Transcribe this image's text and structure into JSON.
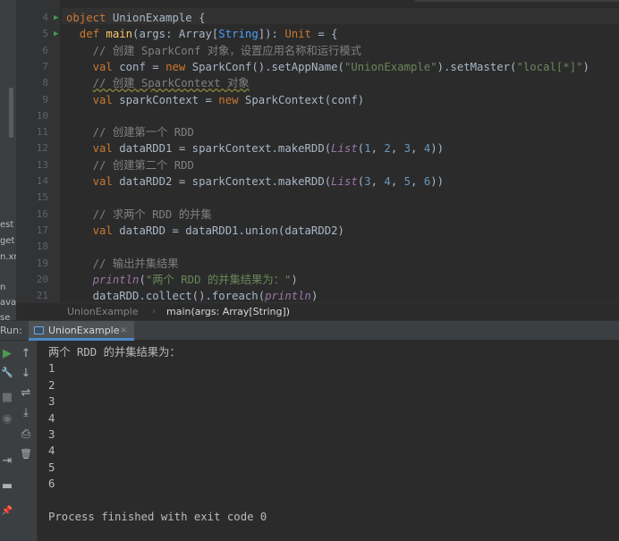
{
  "project_fragments": [
    "est",
    "get",
    "n.xn",
    "n",
    "ava",
    "se"
  ],
  "code_lines": [
    {
      "n": "4",
      "run": true,
      "fold": true,
      "segs": [
        {
          "t": "object ",
          "c": "kw"
        },
        {
          "t": "UnionExample {",
          "c": ""
        }
      ]
    },
    {
      "n": "5",
      "run": true,
      "fold": true,
      "segs": [
        {
          "t": "  def ",
          "c": "kw"
        },
        {
          "t": "main",
          "c": "fn"
        },
        {
          "t": "(args: Array[",
          "c": ""
        },
        {
          "t": "String",
          "c": "type"
        },
        {
          "t": "]): ",
          "c": ""
        },
        {
          "t": "Unit",
          "c": "kw"
        },
        {
          "t": " = {",
          "c": ""
        }
      ]
    },
    {
      "n": "6",
      "segs": [
        {
          "t": "    // 创建 SparkConf 对象，设置应用名称和运行模式",
          "c": "cmt"
        }
      ]
    },
    {
      "n": "7",
      "segs": [
        {
          "t": "    val ",
          "c": "kw"
        },
        {
          "t": "conf = ",
          "c": ""
        },
        {
          "t": "new ",
          "c": "kw"
        },
        {
          "t": "SparkConf().setAppName(",
          "c": ""
        },
        {
          "t": "\"UnionExample\"",
          "c": "str"
        },
        {
          "t": ").setMaster(",
          "c": ""
        },
        {
          "t": "\"local[*]\"",
          "c": "str"
        },
        {
          "t": ")",
          "c": ""
        }
      ]
    },
    {
      "n": "8",
      "segs": [
        {
          "t": "    ",
          "c": ""
        },
        {
          "t": "// 创建 SparkContext 对象",
          "c": "cmt-u"
        }
      ]
    },
    {
      "n": "9",
      "segs": [
        {
          "t": "    val ",
          "c": "kw"
        },
        {
          "t": "sparkContext = ",
          "c": ""
        },
        {
          "t": "new ",
          "c": "kw"
        },
        {
          "t": "SparkContext(conf)",
          "c": ""
        }
      ]
    },
    {
      "n": "10",
      "segs": []
    },
    {
      "n": "11",
      "segs": [
        {
          "t": "    // 创建第一个 RDD",
          "c": "cmt"
        }
      ]
    },
    {
      "n": "12",
      "segs": [
        {
          "t": "    val ",
          "c": "kw"
        },
        {
          "t": "dataRDD1 = sparkContext.makeRDD(",
          "c": ""
        },
        {
          "t": "List",
          "c": "ital"
        },
        {
          "t": "(",
          "c": ""
        },
        {
          "t": "1",
          "c": "num"
        },
        {
          "t": ", ",
          "c": ""
        },
        {
          "t": "2",
          "c": "num"
        },
        {
          "t": ", ",
          "c": ""
        },
        {
          "t": "3",
          "c": "num"
        },
        {
          "t": ", ",
          "c": ""
        },
        {
          "t": "4",
          "c": "num"
        },
        {
          "t": "))",
          "c": ""
        }
      ]
    },
    {
      "n": "13",
      "segs": [
        {
          "t": "    // 创建第二个 RDD",
          "c": "cmt"
        }
      ]
    },
    {
      "n": "14",
      "segs": [
        {
          "t": "    val ",
          "c": "kw"
        },
        {
          "t": "dataRDD2 = sparkContext.makeRDD(",
          "c": ""
        },
        {
          "t": "List",
          "c": "ital"
        },
        {
          "t": "(",
          "c": ""
        },
        {
          "t": "3",
          "c": "num"
        },
        {
          "t": ", ",
          "c": ""
        },
        {
          "t": "4",
          "c": "num"
        },
        {
          "t": ", ",
          "c": ""
        },
        {
          "t": "5",
          "c": "num"
        },
        {
          "t": ", ",
          "c": ""
        },
        {
          "t": "6",
          "c": "num"
        },
        {
          "t": "))",
          "c": ""
        }
      ]
    },
    {
      "n": "15",
      "segs": []
    },
    {
      "n": "16",
      "segs": [
        {
          "t": "    // 求两个 RDD 的并集",
          "c": "cmt"
        }
      ]
    },
    {
      "n": "17",
      "segs": [
        {
          "t": "    val ",
          "c": "kw"
        },
        {
          "t": "dataRDD = dataRDD1.union(dataRDD2)",
          "c": ""
        }
      ]
    },
    {
      "n": "18",
      "segs": []
    },
    {
      "n": "19",
      "segs": [
        {
          "t": "    // 输出并集结果",
          "c": "cmt"
        }
      ]
    },
    {
      "n": "20",
      "segs": [
        {
          "t": "    ",
          "c": ""
        },
        {
          "t": "println",
          "c": "ital"
        },
        {
          "t": "(",
          "c": ""
        },
        {
          "t": "\"两个 RDD 的并集结果为：\"",
          "c": "str"
        },
        {
          "t": ")",
          "c": ""
        }
      ]
    },
    {
      "n": "21",
      "segs": [
        {
          "t": "    dataRDD.collect().foreach(",
          "c": ""
        },
        {
          "t": "println",
          "c": "ital"
        },
        {
          "t": ")",
          "c": ""
        }
      ]
    }
  ],
  "breadcrumb": {
    "object": "UnionExample",
    "separator": "›",
    "method": "main(args: Array[String])"
  },
  "run_panel": {
    "label": "Run:",
    "tab_label": "UnionExample",
    "tab_close": "×"
  },
  "console_lines": [
    "两个 RDD 的并集结果为：",
    "1",
    "2",
    "3",
    "4",
    "3",
    "4",
    "5",
    "6",
    "",
    "Process finished with exit code 0"
  ],
  "icons": {
    "rerun": "▶",
    "settings": "🔧",
    "stop": "■",
    "camera": "◉",
    "exit": "⇥",
    "layout": "▬",
    "pin": "📌",
    "up": "↑",
    "down": "↓",
    "wrap": "⇌",
    "scroll_end": "⤓",
    "print": "⎙",
    "trash": "🗑"
  },
  "colors": {
    "keyword": "#cc7832",
    "string": "#6a8759",
    "number": "#6897bb",
    "comment": "#808080",
    "accent": "#4a88c7"
  }
}
